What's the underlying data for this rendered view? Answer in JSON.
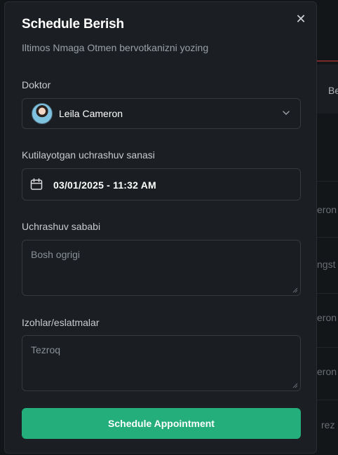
{
  "background": {
    "texts": [
      "Be",
      "eron",
      "ngst",
      "eron",
      "eron",
      "rez"
    ]
  },
  "modal": {
    "title": "Schedule Berish",
    "subtitle": "Iltimos Nmaga Otmen bervotkanizni yozing",
    "close_icon": "close-icon",
    "doctor": {
      "label": "Doktor",
      "selected": "Leila Cameron",
      "icon": "chevron-down-icon"
    },
    "date": {
      "label": "Kutilayotgan uchrashuv sanasi",
      "value": "03/01/2025 - 11:32 AM",
      "icon": "calendar-icon"
    },
    "reason": {
      "label": "Uchrashuv sababi",
      "value": "Bosh ogrigi"
    },
    "notes": {
      "label": "Izohlar/eslatmalar",
      "value": "Tezroq"
    },
    "submit_label": "Schedule Appointment"
  },
  "colors": {
    "accent": "#24ae7c",
    "panel": "#1b1e22",
    "page": "#131619"
  }
}
